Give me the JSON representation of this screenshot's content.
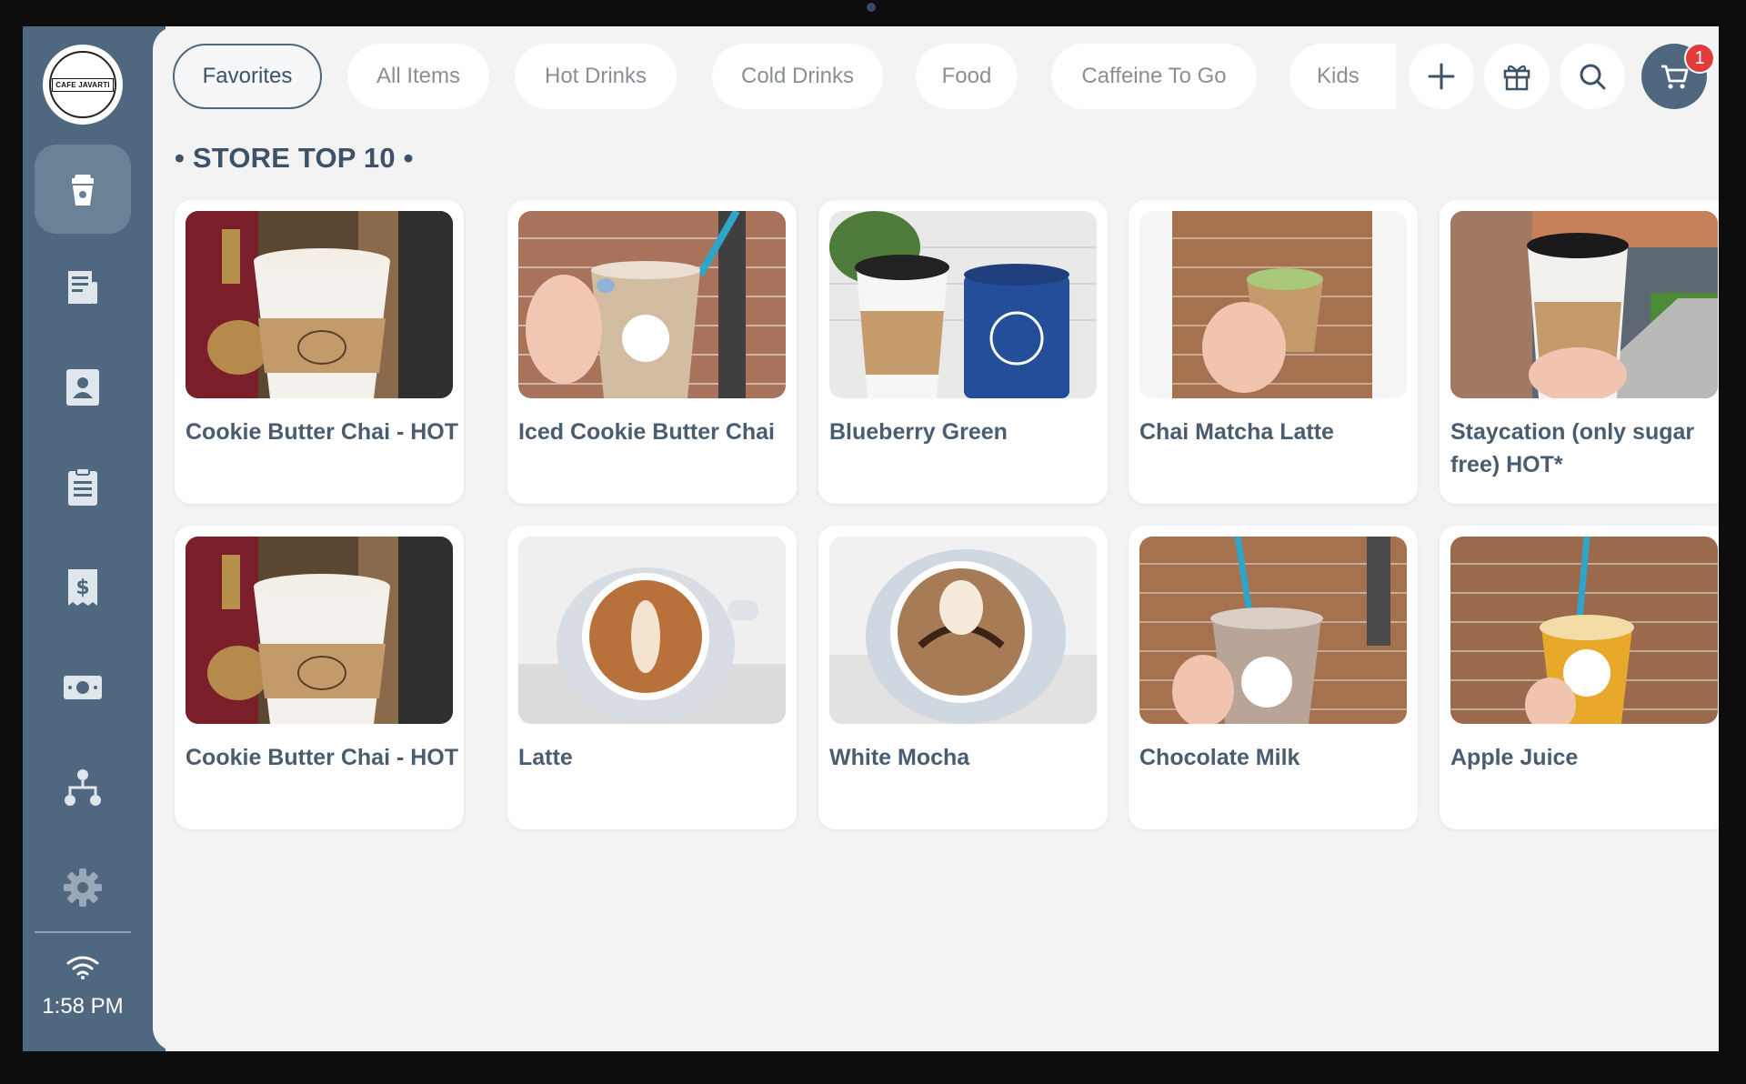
{
  "app": {
    "logo_text": "CAFE JAVARTI",
    "clock": "1:58 PM",
    "accent_color": "#4f6880",
    "badge_color": "#e23b3b"
  },
  "sidebar": {
    "items": [
      {
        "icon": "cup-icon",
        "active": true
      },
      {
        "icon": "orders-icon",
        "active": false
      },
      {
        "icon": "customer-icon",
        "active": false
      },
      {
        "icon": "clipboard-icon",
        "active": false
      },
      {
        "icon": "receipt-dollar-icon",
        "active": false
      },
      {
        "icon": "cash-icon",
        "active": false
      },
      {
        "icon": "hierarchy-icon",
        "active": false
      },
      {
        "icon": "gear-icon",
        "active": false
      }
    ],
    "status_icon": "wifi-icon"
  },
  "tabs": [
    {
      "label": "Favorites",
      "active": true
    },
    {
      "label": "All Items",
      "active": false
    },
    {
      "label": "Hot Drinks",
      "active": false
    },
    {
      "label": "Cold Drinks",
      "active": false
    },
    {
      "label": "Food",
      "active": false
    },
    {
      "label": "Caffeine To Go",
      "active": false
    },
    {
      "label": "Kids",
      "active": false
    }
  ],
  "actions": [
    {
      "icon": "plus-icon"
    },
    {
      "icon": "gift-icon"
    },
    {
      "icon": "search-icon"
    },
    {
      "icon": "cart-icon",
      "badge": "1"
    }
  ],
  "section": {
    "title": "• STORE TOP 10 •"
  },
  "products": [
    {
      "name": "Cookie Butter Chai - HOT",
      "image": "hot-cup-photo"
    },
    {
      "name": "Iced Cookie Butter Chai",
      "image": "iced-cup-photo"
    },
    {
      "name": "Blueberry Green",
      "image": "cup-and-tin-photo"
    },
    {
      "name": "Chai Matcha Latte",
      "image": "matcha-cup-photo"
    },
    {
      "name": "Staycation (only sugar free) HOT*",
      "image": "cup-outdoors-photo"
    },
    {
      "name": "Cookie Butter Chai - HOT",
      "image": "hot-cup-photo"
    },
    {
      "name": "Latte",
      "image": "latte-art-photo"
    },
    {
      "name": "White Mocha",
      "image": "mocha-art-photo"
    },
    {
      "name": "Chocolate Milk",
      "image": "chocolate-milk-photo"
    },
    {
      "name": "Apple Juice",
      "image": "apple-juice-photo"
    }
  ]
}
